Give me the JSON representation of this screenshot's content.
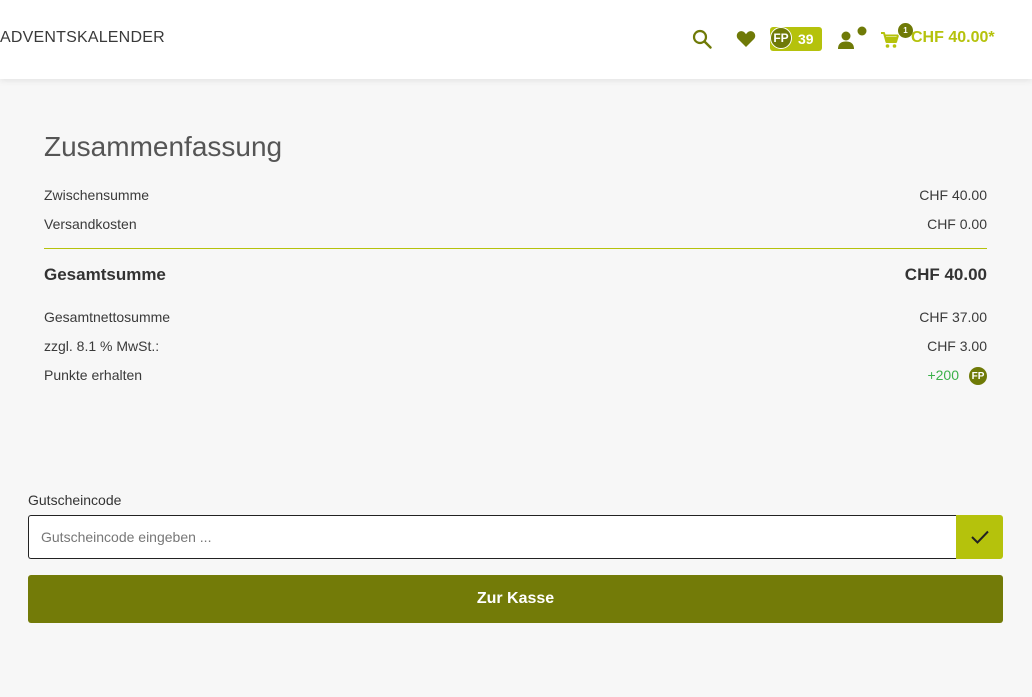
{
  "header": {
    "nav_label": "ADVENTSKALENDER",
    "points_badge_label": "FP",
    "points_count": "39",
    "cart_count": "1",
    "cart_total": "CHF 40.00*",
    "icons": [
      "search-icon",
      "heart-icon",
      "account-icon",
      "cart-icon"
    ]
  },
  "summary": {
    "title": "Zusammenfassung",
    "subtotal_label": "Zwischensumme",
    "subtotal_value": "CHF 40.00",
    "shipping_label": "Versandkosten",
    "shipping_value": "CHF 0.00",
    "total_label": "Gesamtsumme",
    "total_value": "CHF 40.00",
    "net_label": "Gesamtnettosumme",
    "net_value": "CHF 37.00",
    "vat_label": "zzgl. 8.1 % MwSt.:",
    "vat_value": "CHF 3.00",
    "points_label": "Punkte erhalten",
    "points_value": "+200",
    "points_badge": "FP"
  },
  "voucher": {
    "label": "Gutscheincode",
    "placeholder": "Gutscheincode eingeben ...",
    "value": ""
  },
  "checkout": {
    "button_label": "Zur Kasse"
  },
  "colors": {
    "accent": "#b5c20c",
    "dark_accent": "#737b08",
    "points_green": "#3cb14a"
  }
}
